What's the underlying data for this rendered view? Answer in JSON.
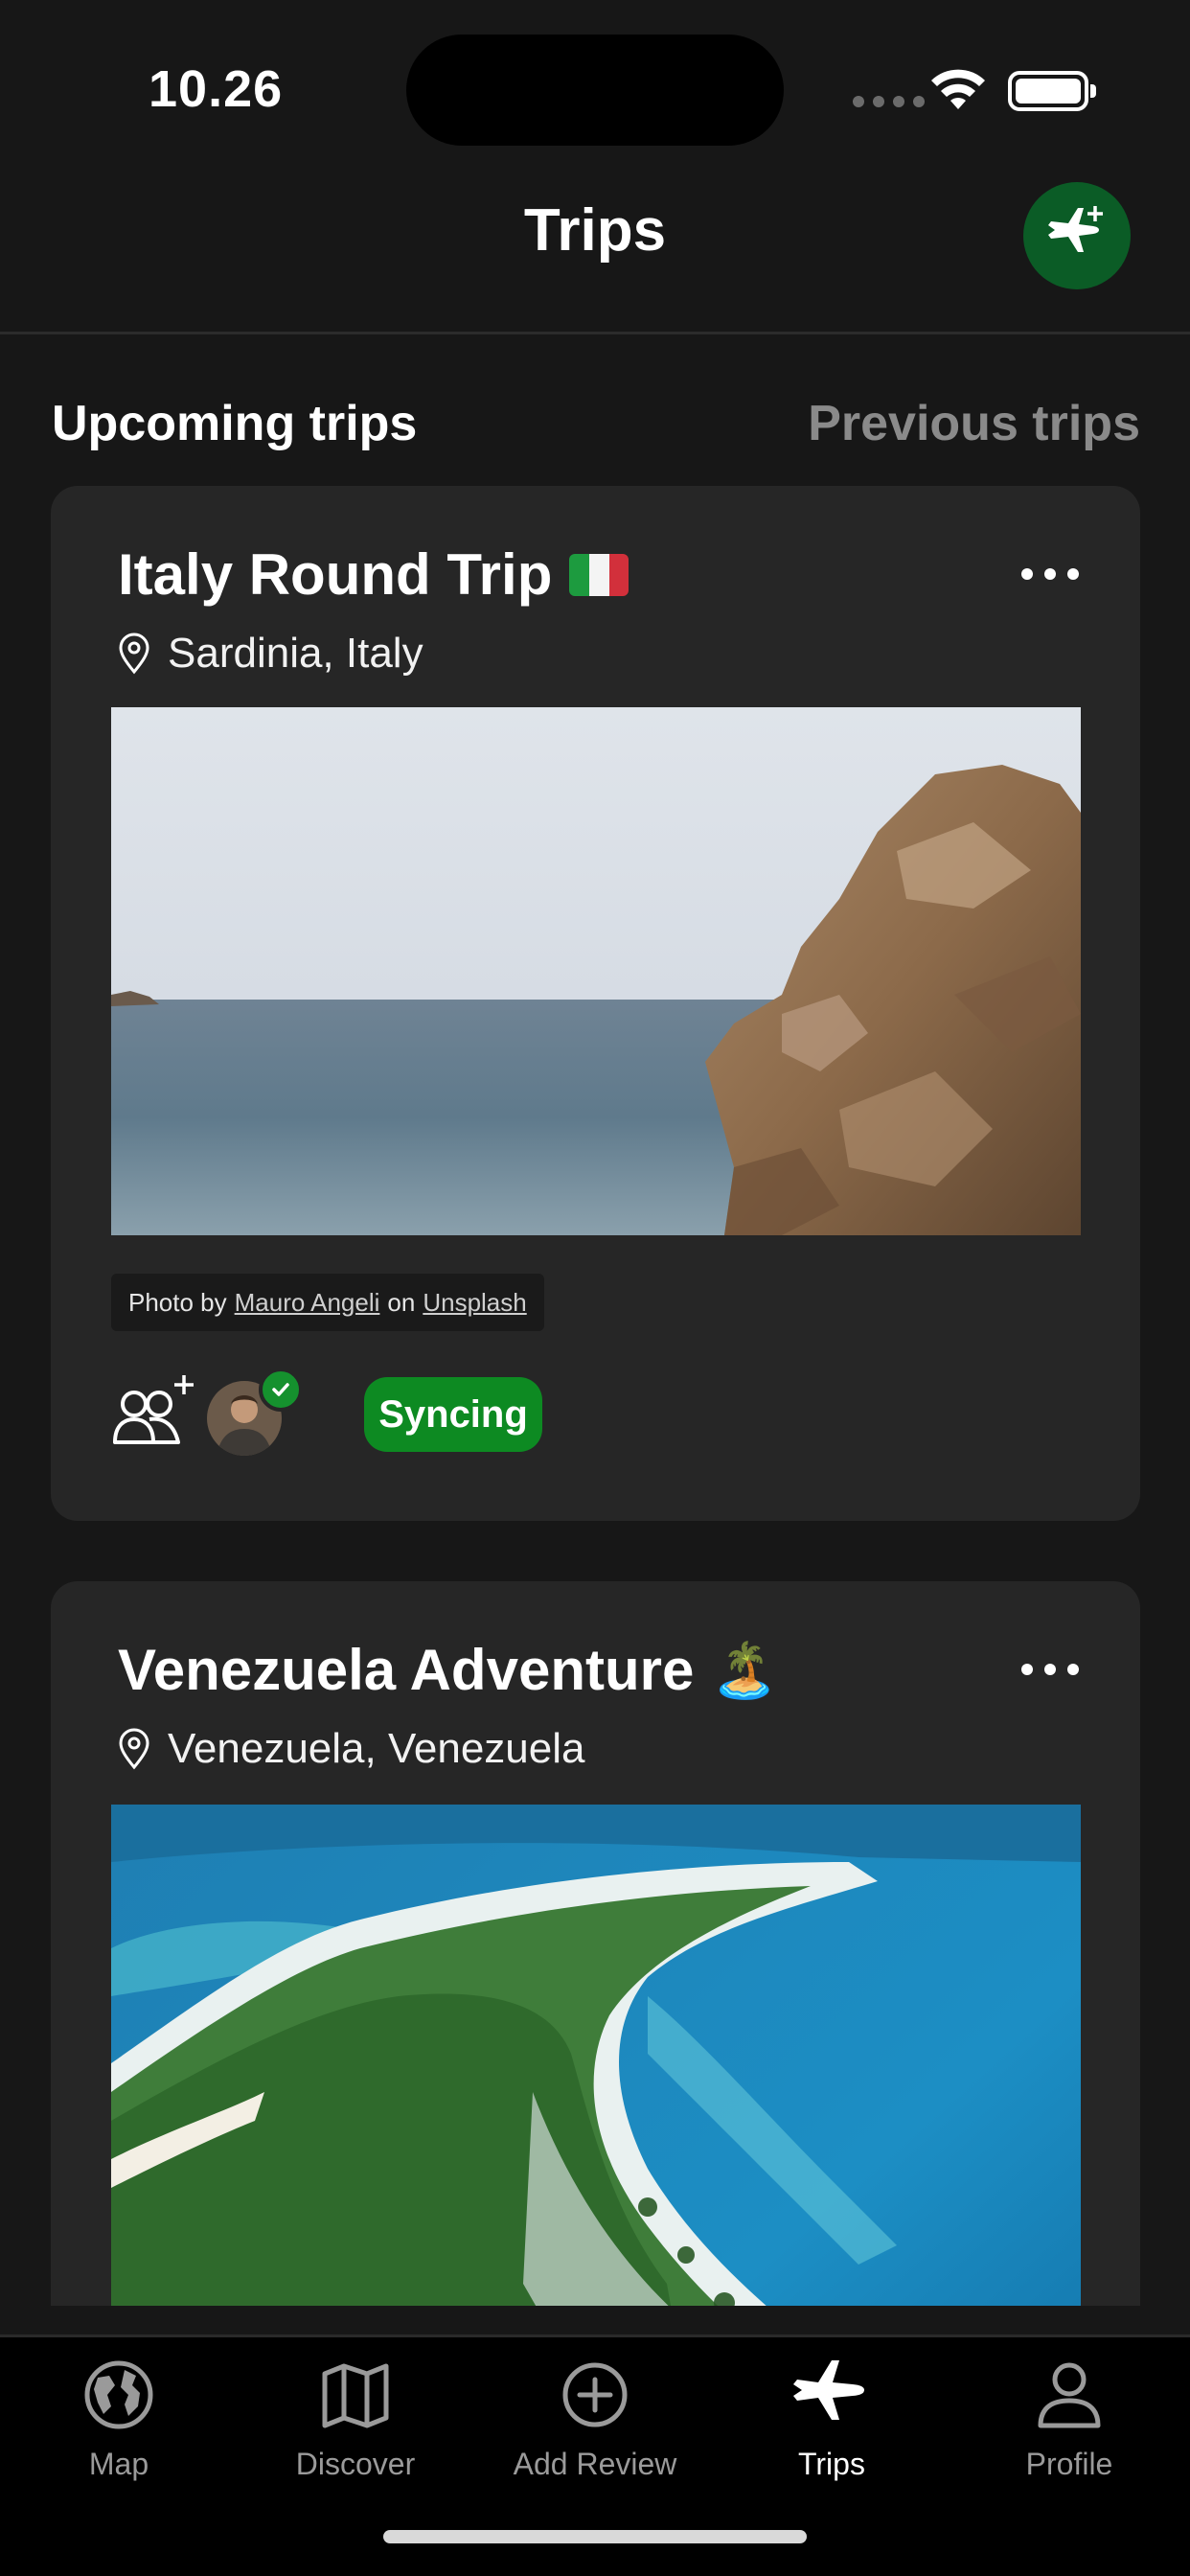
{
  "status_bar": {
    "time": "10.26"
  },
  "header": {
    "title": "Trips"
  },
  "tabs": {
    "upcoming": "Upcoming trips",
    "previous": "Previous trips"
  },
  "trips": [
    {
      "title": "Italy Round Trip",
      "flag": "Italy flag",
      "location": "Sardinia, Italy",
      "photo_credit": {
        "prefix": "Photo by",
        "author": "Mauro Angeli",
        "on": "on",
        "source": "Unsplash"
      },
      "sync_status": "Syncing",
      "status_color": "#0d8a22"
    },
    {
      "title": "Venezuela Adventure",
      "emoji": "🏝️",
      "location": "Venezuela, Venezuela"
    }
  ],
  "bottom_nav": {
    "items": [
      {
        "label": "Map",
        "icon": "globe-icon"
      },
      {
        "label": "Discover",
        "icon": "map-icon"
      },
      {
        "label": "Add Review",
        "icon": "plus-circle-icon"
      },
      {
        "label": "Trips",
        "icon": "airplane-icon"
      },
      {
        "label": "Profile",
        "icon": "person-icon"
      }
    ],
    "active": "Trips"
  },
  "colors": {
    "background": "#171717",
    "card": "#262626",
    "accent_green": "#0b5c26",
    "badge_green": "#0d8a22"
  }
}
